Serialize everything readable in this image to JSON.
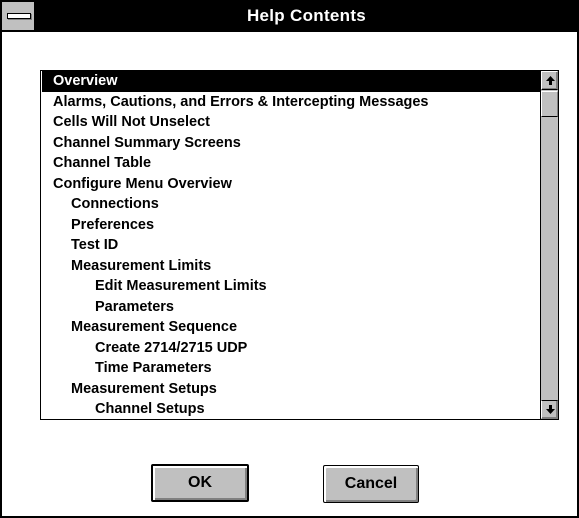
{
  "window": {
    "title": "Help Contents"
  },
  "list": {
    "items": [
      {
        "label": "Overview",
        "level": 0,
        "selected": true
      },
      {
        "label": "Alarms, Cautions, and Errors & Intercepting Messages",
        "level": 0
      },
      {
        "label": "Cells Will Not Unselect",
        "level": 0
      },
      {
        "label": "Channel Summary Screens",
        "level": 0
      },
      {
        "label": "Channel Table",
        "level": 0
      },
      {
        "label": "Configure Menu Overview",
        "level": 0
      },
      {
        "label": "Connections",
        "level": 1
      },
      {
        "label": "Preferences",
        "level": 1
      },
      {
        "label": "Test ID",
        "level": 1
      },
      {
        "label": "Measurement Limits",
        "level": 1
      },
      {
        "label": "Edit Measurement Limits",
        "level": 2
      },
      {
        "label": "Parameters",
        "level": 2
      },
      {
        "label": "Measurement Sequence",
        "level": 1
      },
      {
        "label": "Create 2714/2715 UDP",
        "level": 2
      },
      {
        "label": "Time Parameters",
        "level": 2
      },
      {
        "label": "Measurement Setups",
        "level": 1
      },
      {
        "label": "Channel Setups",
        "level": 2
      }
    ]
  },
  "buttons": {
    "ok_label": "OK",
    "cancel_label": "Cancel"
  },
  "icons": {
    "system_menu": "system-menu-icon",
    "scroll_up": "up-arrow-icon",
    "scroll_down": "down-arrow-icon"
  },
  "colors": {
    "title_bar": "#000000",
    "title_text": "#ffffff",
    "face": "#c0c0c0",
    "selection": "#000000"
  }
}
